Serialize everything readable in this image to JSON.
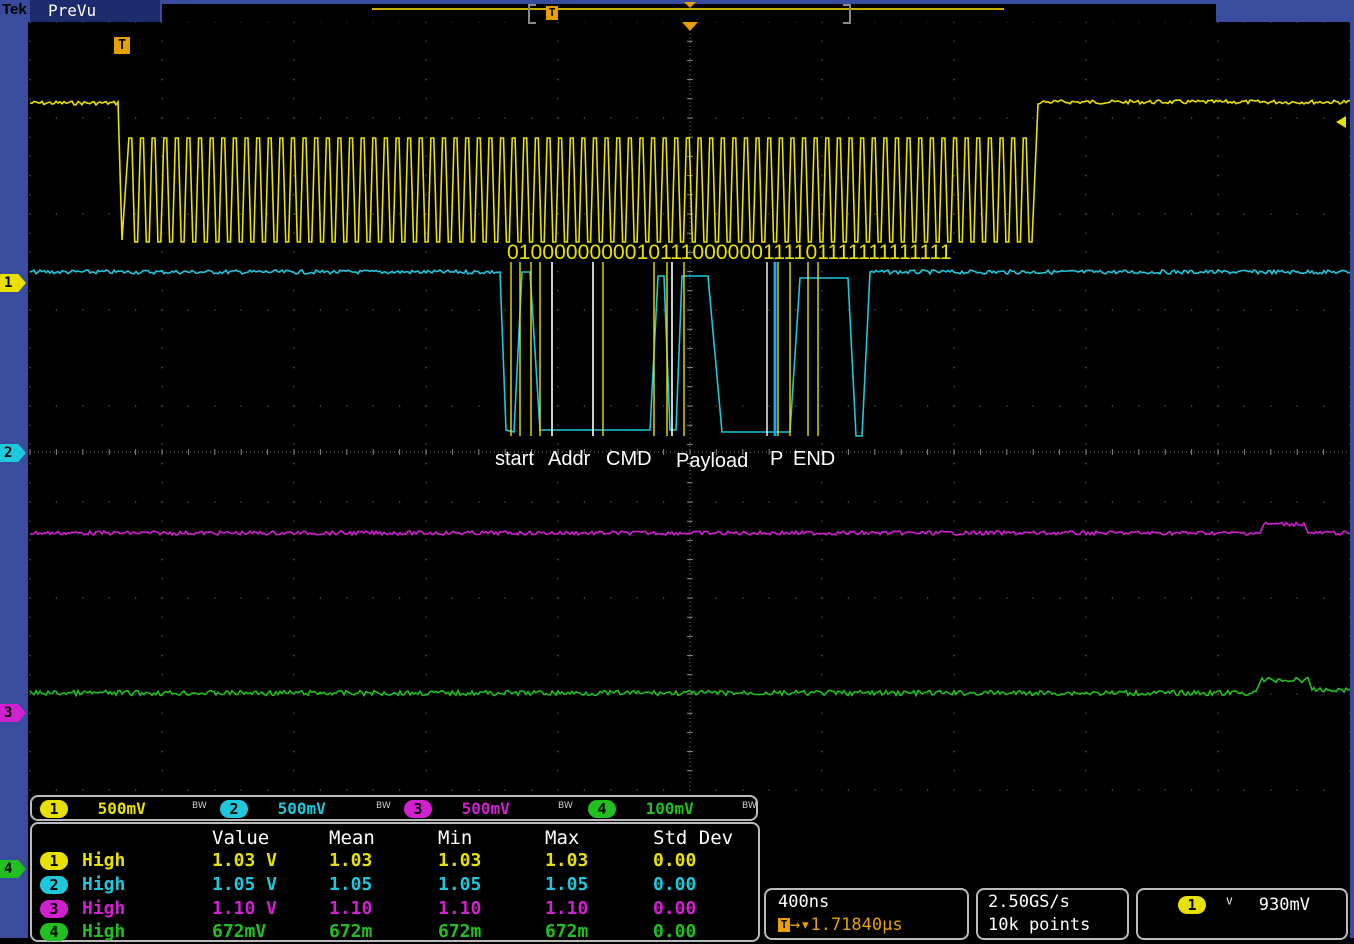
{
  "header": {
    "brand": "Tek",
    "mode": "PreVu",
    "trigger_marker": "T"
  },
  "trace_colors": {
    "ch1": "#e8e000",
    "ch2": "#1ec8dc",
    "ch3": "#d020d0",
    "ch4": "#20c020"
  },
  "channel_markers": [
    "1",
    "2",
    "3",
    "4"
  ],
  "trigger_label": "T",
  "decoded_bits": "0100000000010111000000111101111111111111",
  "protocol_fields": [
    "start",
    "Addr",
    "CMD",
    "Payload",
    "P",
    "END"
  ],
  "channels": [
    {
      "id": "1",
      "scale": "500mV",
      "bw": "BW",
      "color": "#e8e000"
    },
    {
      "id": "2",
      "scale": "500mV",
      "bw": "BW",
      "color": "#1ec8dc"
    },
    {
      "id": "3",
      "scale": "500mV",
      "bw": "BW",
      "color": "#d020d0"
    },
    {
      "id": "4",
      "scale": "100mV",
      "bw": "BW",
      "color": "#20c020"
    }
  ],
  "measurements": {
    "headers": [
      "Value",
      "Mean",
      "Min",
      "Max",
      "Std Dev"
    ],
    "rows": [
      {
        "ch": "1",
        "name": "High",
        "value": "1.03 V",
        "mean": "1.03",
        "min": "1.03",
        "max": "1.03",
        "std": "0.00",
        "color": "#e8e000"
      },
      {
        "ch": "2",
        "name": "High",
        "value": "1.05 V",
        "mean": "1.05",
        "min": "1.05",
        "max": "1.05",
        "std": "0.00",
        "color": "#1ec8dc"
      },
      {
        "ch": "3",
        "name": "High",
        "value": "1.10 V",
        "mean": "1.10",
        "min": "1.10",
        "max": "1.10",
        "std": "0.00",
        "color": "#d020d0"
      },
      {
        "ch": "4",
        "name": "High",
        "value": "672mV",
        "mean": "672m",
        "min": "672m",
        "max": "672m",
        "std": "0.00",
        "color": "#20c020"
      }
    ]
  },
  "timebase": {
    "scale": "400ns",
    "position": "1.71840µs"
  },
  "acquisition": {
    "rate": "2.50GS/s",
    "points": "10k points"
  },
  "trigger": {
    "source": "1",
    "slope": "ⱽ",
    "level": "930mV"
  }
}
